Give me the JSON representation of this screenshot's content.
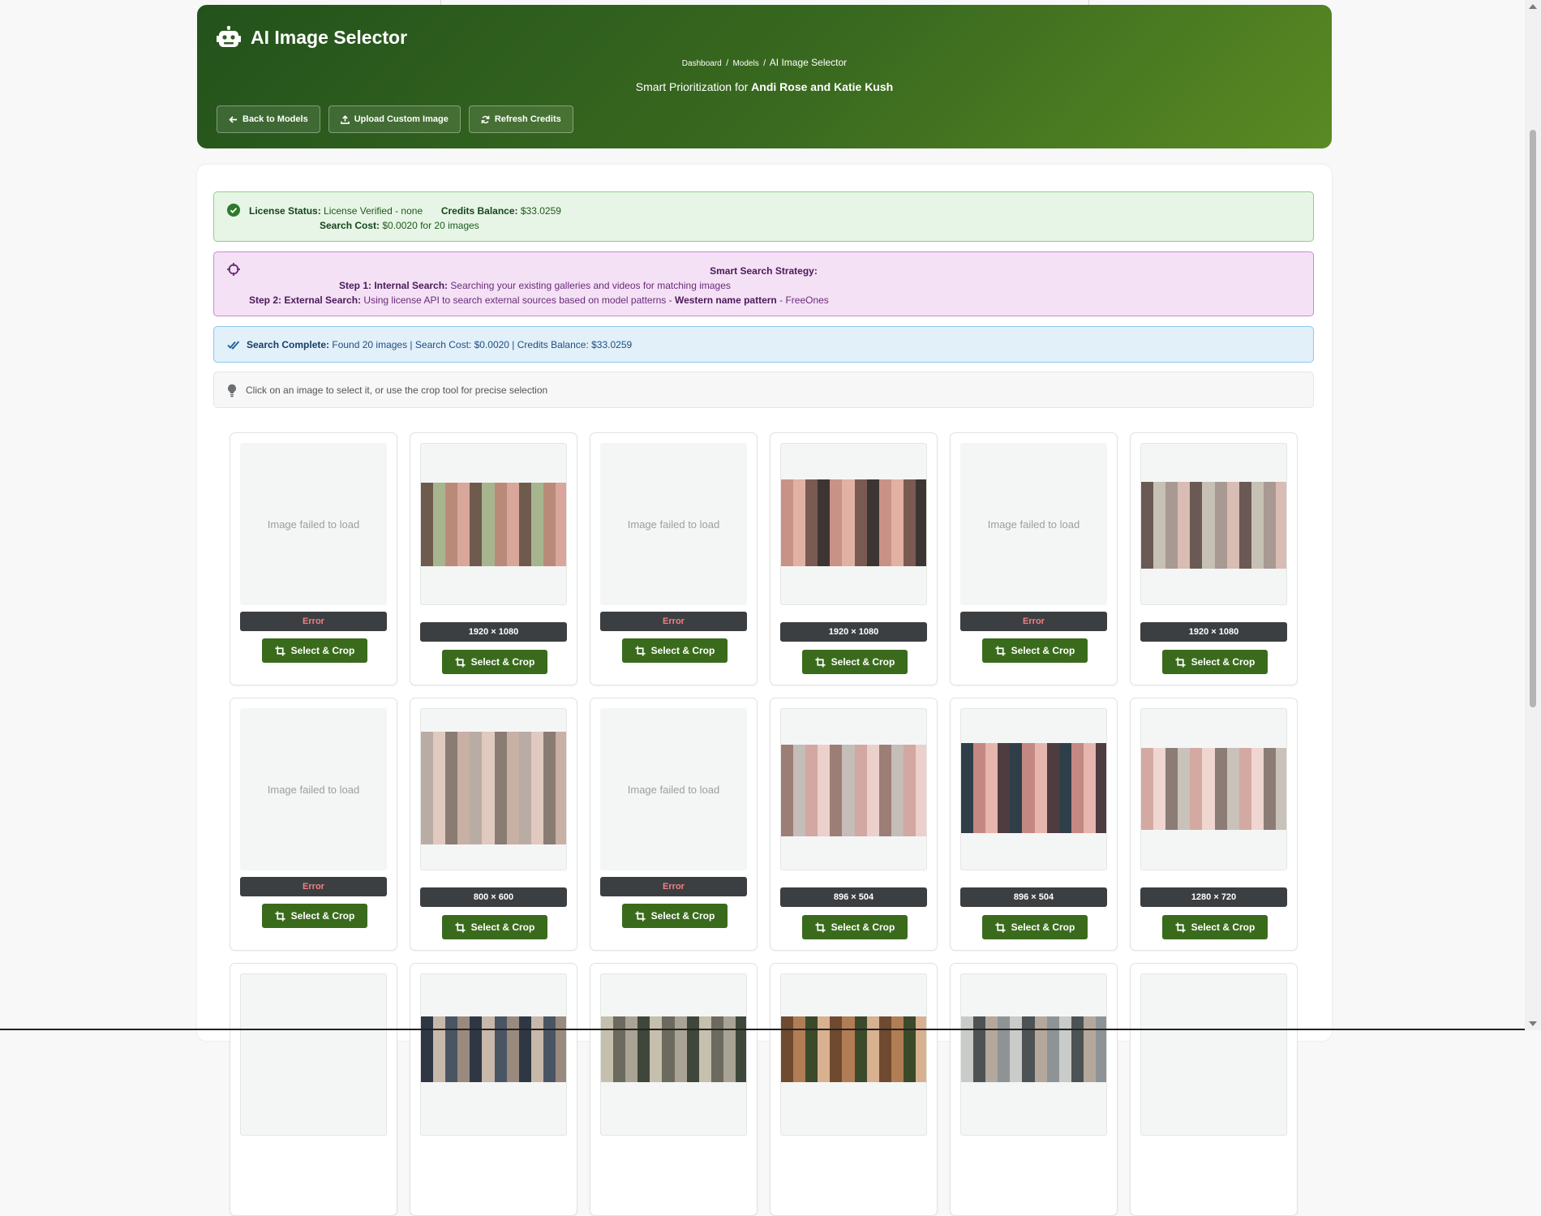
{
  "header": {
    "title": "AI Image Selector",
    "breadcrumb": {
      "dashboard": "Dashboard",
      "models": "Models",
      "current": "AI Image Selector",
      "separator": "/"
    },
    "subtitle_prefix": "Smart Prioritization for",
    "subtitle_model": "Andi Rose and Katie Kush",
    "buttons": {
      "back": "Back to Models",
      "upload": "Upload Custom Image",
      "refresh": "Refresh Credits"
    }
  },
  "license": {
    "status_label": "License Status:",
    "status_value": "License Verified - none",
    "balance_label": "Credits Balance:",
    "balance_value": "$33.0259",
    "cost_label": "Search Cost:",
    "cost_value": "$0.0020 for 20 images"
  },
  "strategy": {
    "title": "Smart Search Strategy:",
    "step1_label": "Step 1: Internal Search:",
    "step1_text": "Searching your existing galleries and videos for matching images",
    "step2_label": "Step 2: External Search:",
    "step2_text": "Using license API to search external sources based on model patterns -",
    "step2_pattern": "Western name pattern",
    "step2_suffix": "- FreeOnes"
  },
  "search_complete": {
    "label": "Search Complete:",
    "text": "Found 20 images | Search Cost: $0.0020 | Credits Balance: $33.0259"
  },
  "hint": "Click on an image to select it, or use the crop tool for precise selection",
  "tile_labels": {
    "failed": "Image failed to load",
    "select": "Select & Crop",
    "error": "Error"
  },
  "images": [
    {
      "status": "error",
      "badge": "Error"
    },
    {
      "status": "ok",
      "badge": "1920 × 1080",
      "palette": [
        "#b98a78",
        "#d8a69a",
        "#6f5a4e",
        "#a7b58f"
      ]
    },
    {
      "status": "error",
      "badge": "Error"
    },
    {
      "status": "ok",
      "badge": "1920 × 1080",
      "palette": [
        "#c99286",
        "#e1b2a4",
        "#7a5b52",
        "#3d3533"
      ]
    },
    {
      "status": "error",
      "badge": "Error"
    },
    {
      "status": "ok",
      "badge": "1920 × 1080",
      "palette": [
        "#a89992",
        "#d9bcb3",
        "#6a5954",
        "#c7c1b5"
      ]
    },
    {
      "status": "error",
      "badge": "Error"
    },
    {
      "status": "ok",
      "badge": "800 × 600",
      "palette": [
        "#b9aca4",
        "#e0c9be",
        "#8a7c73",
        "#c9b0a4"
      ]
    },
    {
      "status": "error",
      "badge": "Error"
    },
    {
      "status": "ok",
      "badge": "896 × 504",
      "palette": [
        "#d3a7a2",
        "#ebd0cb",
        "#9c7e77",
        "#c5bdb7"
      ]
    },
    {
      "status": "ok",
      "badge": "896 × 504",
      "palette": [
        "#c48882",
        "#e6b5ae",
        "#4e3c40",
        "#2f3f4a"
      ]
    },
    {
      "status": "ok",
      "badge": "1280 × 720",
      "palette": [
        "#d3a9a2",
        "#efd6d0",
        "#8c7c76",
        "#c9c2ba"
      ]
    },
    {
      "status": "partial",
      "palette": [
        "#f4f6f5",
        "#f4f6f5",
        "#f4f6f5",
        "#f4f6f5"
      ]
    },
    {
      "status": "partial",
      "palette": [
        "#4a5564",
        "#9a8a7e",
        "#2f3744",
        "#c7b8aa"
      ]
    },
    {
      "status": "partial",
      "palette": [
        "#6c6a5e",
        "#a8a394",
        "#3f473a",
        "#c5bfae"
      ]
    },
    {
      "status": "partial",
      "palette": [
        "#6f4a30",
        "#b17d55",
        "#3b4a2a",
        "#d8b190"
      ]
    },
    {
      "status": "partial",
      "palette": [
        "#8e9496",
        "#c9cbc9",
        "#4d5355",
        "#b4a89c"
      ]
    },
    {
      "status": "partial",
      "palette": [
        "#f4f6f5",
        "#f4f6f5",
        "#f4f6f5",
        "#f4f6f5"
      ]
    }
  ]
}
